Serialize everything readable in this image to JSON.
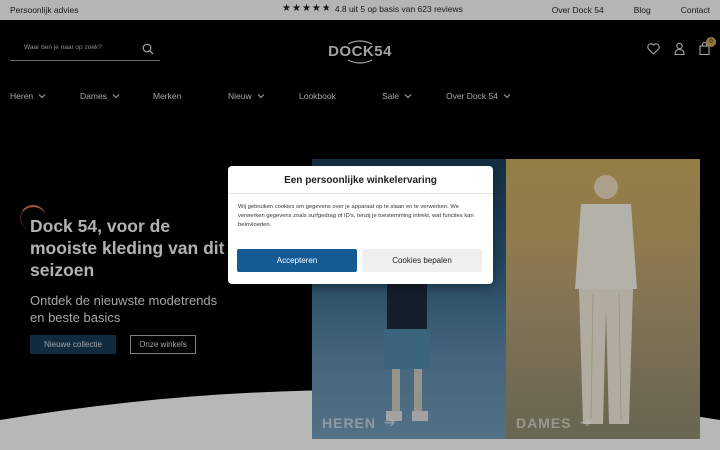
{
  "topbar": {
    "advice": "Persoonlijk advies",
    "rating_text": "4.8 uit 5 op basis van 623 reviews",
    "rating_stars": 4.8,
    "links": [
      "Over Dock 54",
      "Blog",
      "Contact"
    ]
  },
  "header": {
    "search_placeholder": "Waar ben je naar op zoek?",
    "logo": "DOCK54",
    "cart_count": "0",
    "icons": [
      "heart-icon",
      "user-icon",
      "bag-icon",
      "search-icon"
    ]
  },
  "nav": {
    "items": [
      {
        "label": "Heren",
        "dropdown": true
      },
      {
        "label": "Dames",
        "dropdown": true
      },
      {
        "label": "Merken",
        "dropdown": false
      },
      {
        "label": "Nieuw",
        "dropdown": true
      },
      {
        "label": "Lookbook",
        "dropdown": false
      },
      {
        "label": "Sale",
        "dropdown": true
      },
      {
        "label": "Over Dock 54",
        "dropdown": true
      }
    ]
  },
  "hero": {
    "title": "Dock 54, voor de mooiste kleding van dit seizoen",
    "subtitle": "Ontdek de nieuwste modetrends en beste basics",
    "primary_button": "Nieuwe collectie",
    "secondary_button": "Onze winkels",
    "panels": [
      {
        "label": "HEREN"
      },
      {
        "label": "DAMES"
      }
    ]
  },
  "cookie_modal": {
    "title": "Een persoonlijke winkelervaring",
    "text": "Wij gebruiken cookies om gegevens over je apparaat op te slaan en te verwerken. We verwerken gegevens zoals surfgedrag of ID's, tenzij je toestemming intrekt, wat functies kan beïnvloeden.",
    "accept": "Accepteren",
    "settings": "Cookies bepalen"
  },
  "colors": {
    "accent": "#145b96",
    "badge": "#c9a24b",
    "topbar_bg": "#f2f2f2",
    "background": "#000000"
  }
}
